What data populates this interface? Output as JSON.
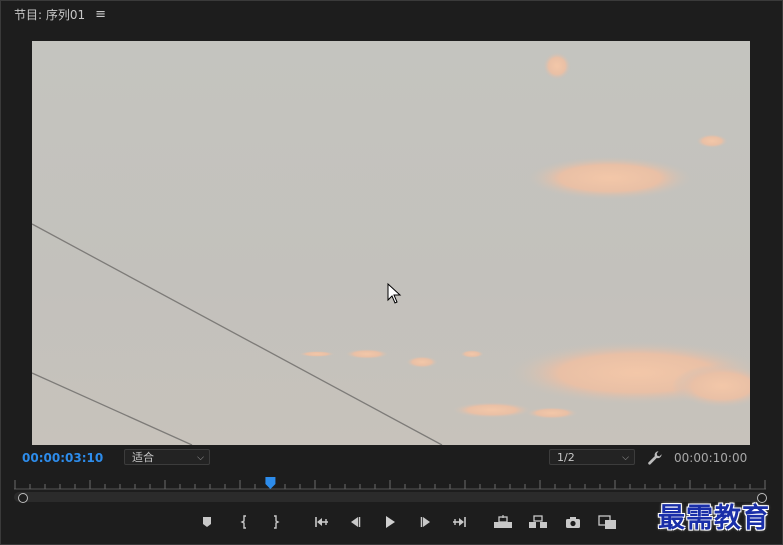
{
  "panel": {
    "title": "节目: 序列01",
    "menu_icon": "hamburger-icon"
  },
  "monitor": {
    "content": "sky-with-power-lines"
  },
  "timebar": {
    "current_timecode": "00:00:03:10",
    "fit_select": "适合",
    "resolution_select": "1/2",
    "duration_timecode": "00:00:10:00",
    "settings_icon": "wrench-icon"
  },
  "playback": {
    "playhead_fraction": 0.341
  },
  "controls": [
    {
      "name": "add-marker-button",
      "icon": "marker-icon"
    },
    {
      "name": "mark-in-button",
      "icon": "mark-in-icon"
    },
    {
      "name": "mark-out-button",
      "icon": "mark-out-icon"
    },
    {
      "name": "go-to-in-button",
      "icon": "go-to-in-icon"
    },
    {
      "name": "step-back-button",
      "icon": "step-back-icon"
    },
    {
      "name": "play-button",
      "icon": "play-icon"
    },
    {
      "name": "step-forward-button",
      "icon": "step-forward-icon"
    },
    {
      "name": "go-to-out-button",
      "icon": "go-to-out-icon"
    },
    {
      "name": "lift-button",
      "icon": "lift-icon"
    },
    {
      "name": "extract-button",
      "icon": "extract-icon"
    },
    {
      "name": "export-frame-button",
      "icon": "camera-icon"
    },
    {
      "name": "compare-view-button",
      "icon": "compare-icon"
    }
  ],
  "watermark": "最需教育",
  "colors": {
    "accent": "#2d8ceb",
    "panel_bg": "#1d1d1d"
  }
}
